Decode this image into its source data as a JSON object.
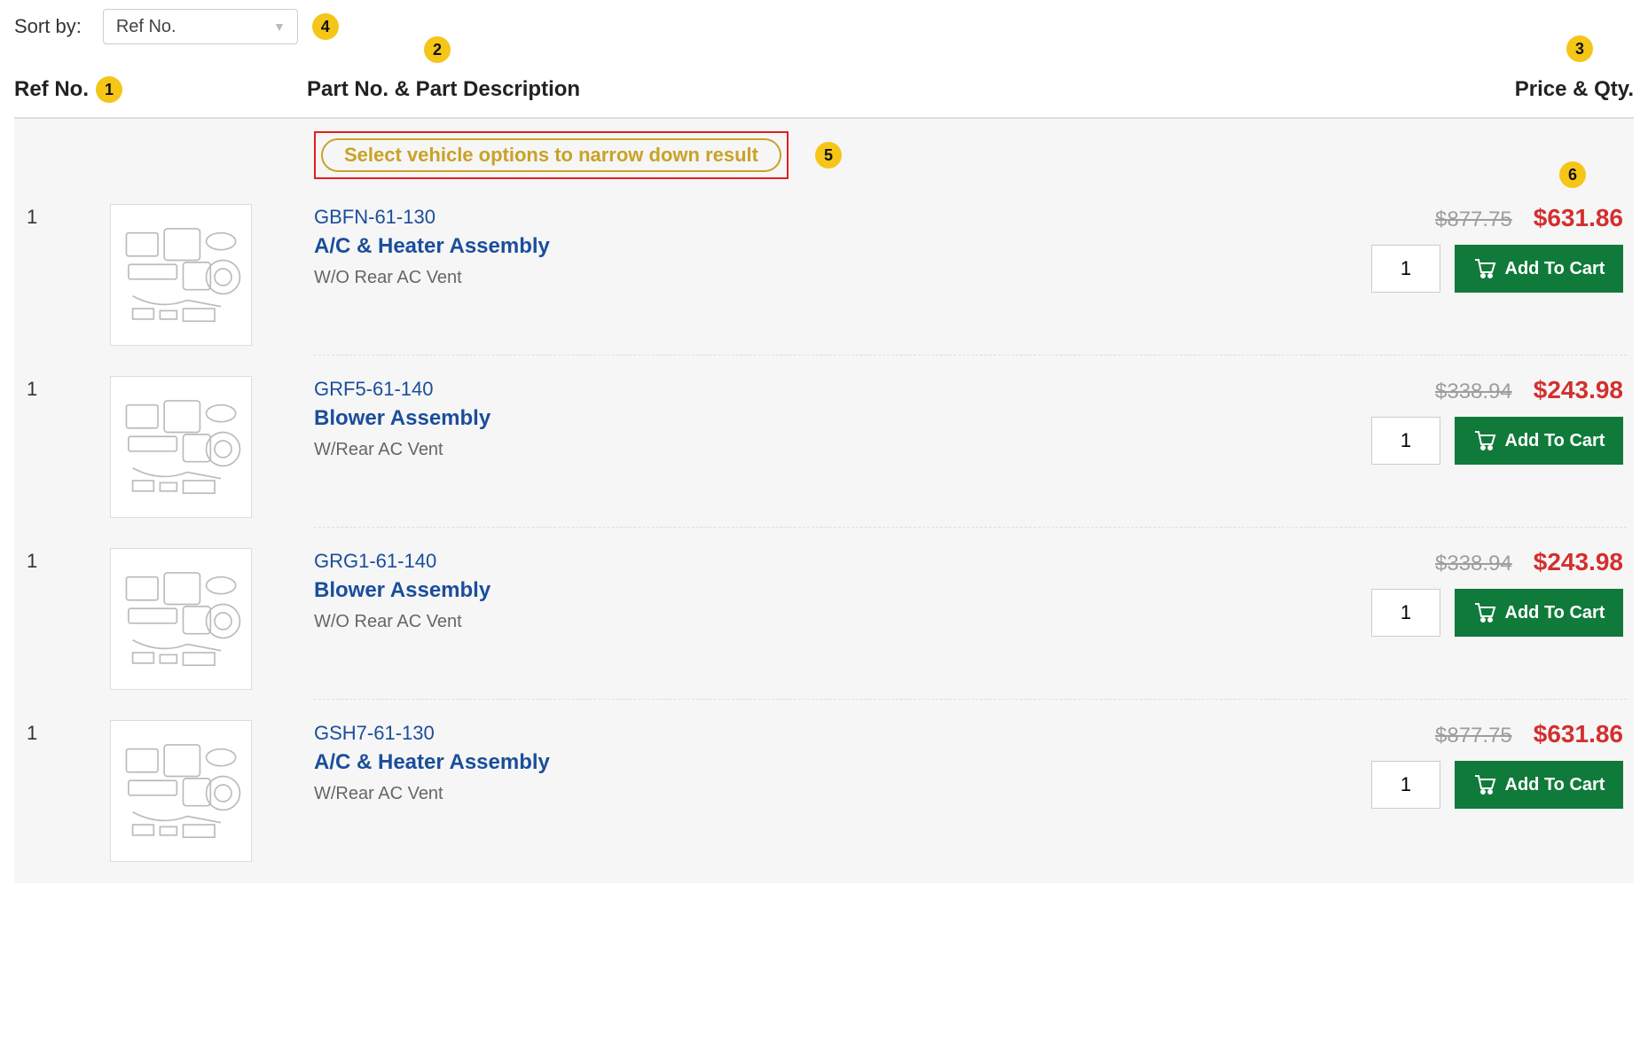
{
  "sort": {
    "label": "Sort by:",
    "selected": "Ref No."
  },
  "headers": {
    "ref": "Ref No.",
    "part": "Part No. & Part Description",
    "price": "Price & Qty."
  },
  "narrow_banner": "Select vehicle options to narrow down result",
  "add_to_cart_label": "Add To Cart",
  "badges": {
    "b1": "1",
    "b2": "2",
    "b3": "3",
    "b4": "4",
    "b5": "5",
    "b6": "6"
  },
  "parts": [
    {
      "ref": "1",
      "part_no": "GBFN-61-130",
      "name": "A/C & Heater Assembly",
      "note": "W/O Rear AC Vent",
      "old_price": "$877.75",
      "new_price": "$631.86",
      "qty": "1"
    },
    {
      "ref": "1",
      "part_no": "GRF5-61-140",
      "name": "Blower Assembly",
      "note": "W/Rear AC Vent",
      "old_price": "$338.94",
      "new_price": "$243.98",
      "qty": "1"
    },
    {
      "ref": "1",
      "part_no": "GRG1-61-140",
      "name": "Blower Assembly",
      "note": "W/O Rear AC Vent",
      "old_price": "$338.94",
      "new_price": "$243.98",
      "qty": "1"
    },
    {
      "ref": "1",
      "part_no": "GSH7-61-130",
      "name": "A/C & Heater Assembly",
      "note": "W/Rear AC Vent",
      "old_price": "$877.75",
      "new_price": "$631.86",
      "qty": "1"
    }
  ]
}
